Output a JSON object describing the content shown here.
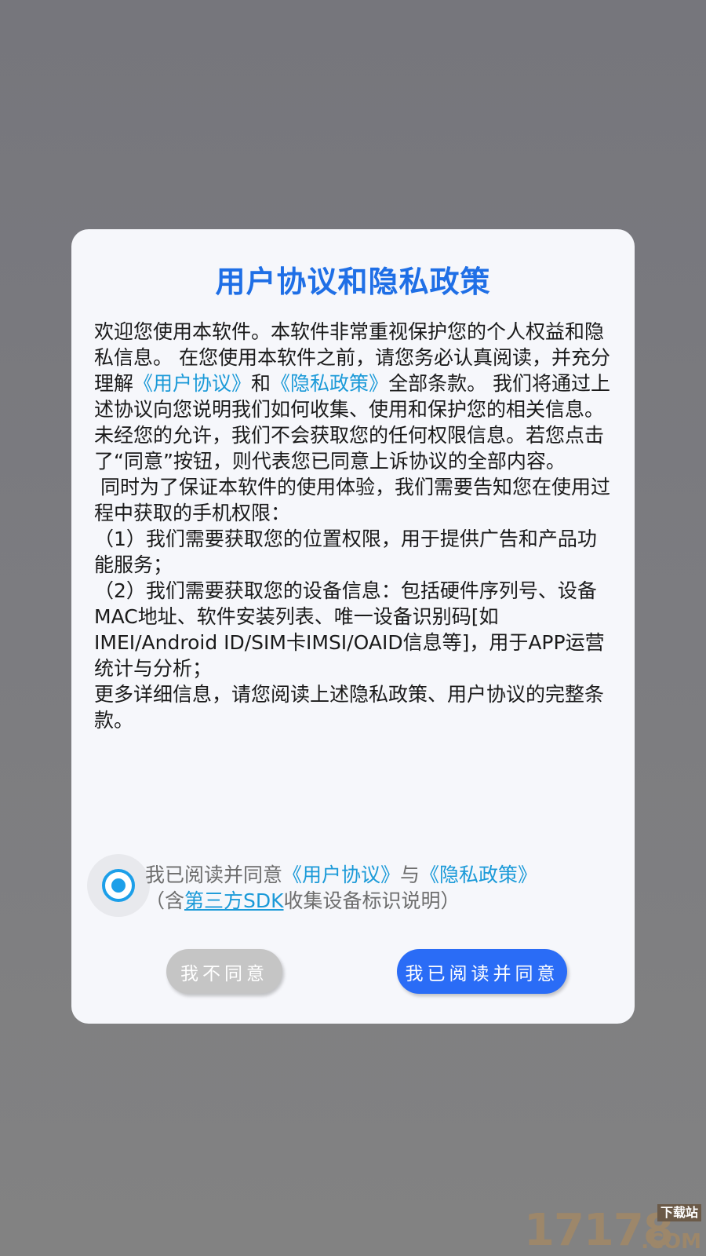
{
  "dialog": {
    "title": "用户协议和隐私政策",
    "intro": {
      "part1": "欢迎您使用本软件。本软件非常重视保护您的个人权益和隐私信息。 在您使用本软件之前，请您务必认真阅读，并充分理解",
      "link_user_agreement": "《用户协议》",
      "and": "和",
      "link_privacy_policy": "《隐私政策》",
      "part2": "全部条款。 我们将通过上述协议向您说明我们如何收集、使用和保护您的相关信息。 未经您的允许，我们不会获取您的任何权限信息。若您点击了“同意”按钮，则代表您已同意上诉协议的全部内容。"
    },
    "paragraph2": " 同时为了保证本软件的使用体验，我们需要告知您在使用过程中获取的手机权限：",
    "item1": "（1）我们需要获取您的位置权限，用于提供广告和产品功能服务；",
    "item2": "（2）我们需要获取您的设备信息：包括硬件序列号、设备MAC地址、软件安装列表、唯一设备识别码[如IMEI/Android ID/SIM卡IMSI/OAID信息等]，用于APP运营统计与分析；",
    "closing": "更多详细信息，请您阅读上述隐私政策、用户协议的完整条款。",
    "consent": {
      "checked": true,
      "prefix": "我已阅读并同意",
      "link_user_agreement": "《用户协议》",
      "and": "与",
      "link_privacy_policy": "《隐私政策》",
      "line2_prefix": "（含",
      "link_sdk": "第三方SDK",
      "line2_suffix": "收集设备标识说明）"
    },
    "buttons": {
      "disagree": "我不同意",
      "agree": "我已阅读并同意"
    }
  },
  "watermark": {
    "digits": "17178",
    "tag": "下载站",
    "domain": ".COM"
  },
  "colors": {
    "title": "#1f6fe6",
    "link": "#1b9ad8",
    "agree_button": "#2a6cf6",
    "disagree_button": "#c5c5c5",
    "radio": "#1c9fe9"
  }
}
